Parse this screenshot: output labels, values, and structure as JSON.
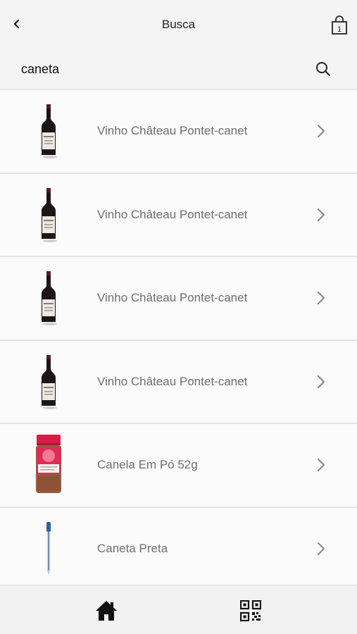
{
  "header": {
    "title": "Busca",
    "back_icon": "chevron-left-icon",
    "cart_icon": "shopping-bag-icon",
    "cart_count": "1"
  },
  "search": {
    "value": "caneta",
    "placeholder": "",
    "icon": "search-icon"
  },
  "results": [
    {
      "label": "Vinho Château Pontet-canet",
      "thumb": "wine-bottle"
    },
    {
      "label": "Vinho Château Pontet-canet",
      "thumb": "wine-bottle"
    },
    {
      "label": "Vinho Château Pontet-canet",
      "thumb": "wine-bottle"
    },
    {
      "label": "Vinho Château Pontet-canet",
      "thumb": "wine-bottle"
    },
    {
      "label": "Canela Em Pó 52g",
      "thumb": "spice-jar"
    },
    {
      "label": "Caneta Preta",
      "thumb": "pen"
    }
  ],
  "bottom_nav": {
    "items": [
      {
        "icon": "home-icon"
      },
      {
        "icon": "qr-code-icon"
      }
    ]
  },
  "colors": {
    "background": "#f4f4f4",
    "row_background": "#fbfbfb",
    "label_text": "#6e6e6e",
    "chevron": "#8a8a8a",
    "wine_dark": "#1e1516",
    "jar_red": "#d81d48"
  }
}
